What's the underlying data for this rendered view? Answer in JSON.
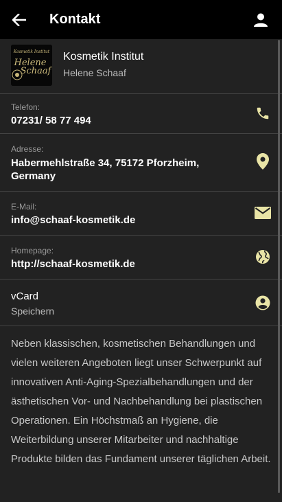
{
  "appbar": {
    "title": "Kontakt",
    "back_icon": "arrow-back-icon",
    "account_icon": "person-icon"
  },
  "profile": {
    "logo_text_top": "Kosmetik Institut",
    "logo_text_name": "Helene Schaaf",
    "name": "Kosmetik Institut",
    "subtitle": "Helene Schaaf"
  },
  "contact": {
    "phone_label": "Telefon:",
    "phone_value": "07231/ 58 77 494",
    "address_label": "Adresse:",
    "address_value": "Habermehlstraße 34, 75172 Pforzheim, Germany",
    "email_label": "E-Mail:",
    "email_value": "info@schaaf-kosmetik.de",
    "homepage_label": "Homepage:",
    "homepage_value": "http://schaaf-kosmetik.de",
    "vcard_title": "vCard",
    "vcard_action": "Speichern"
  },
  "description": "Neben klassischen, kosmetischen Behandlungen und vielen weiteren Angeboten liegt unser Schwerpunkt auf innovativen Anti-Aging-Spezialbehandlungen und der ästhetischen Vor- und Nachbehandlung bei plastischen Operationen. Ein Höchstmaß an Hygiene, die Weiterbildung unserer Mitarbeiter und nachhaltige Produkte bilden das Fundament unserer täglichen Arbeit.",
  "colors": {
    "accent_icon": "#e9e4a6",
    "appbar_bg": "#000000",
    "page_bg": "#222222",
    "divider": "#444444"
  }
}
